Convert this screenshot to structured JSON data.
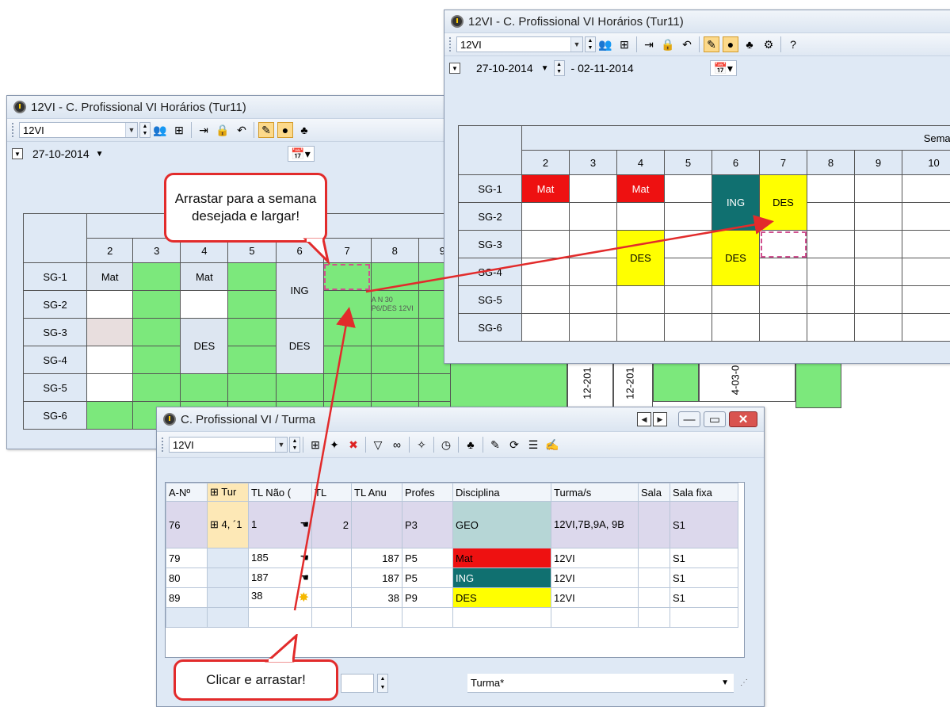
{
  "back_window": {
    "title": "12VI - C. Profissional VI  Horários  (Tur11)",
    "class_combo": "12VI",
    "date_start": "27-10-2014",
    "columns": [
      "",
      "2",
      "3",
      "4",
      "5",
      "6",
      "7",
      "8",
      "9"
    ],
    "rows": [
      "SG-1",
      "SG-2",
      "SG-3",
      "SG-4",
      "SG-5",
      "SG-6"
    ],
    "cells": {
      "mat1": "Mat",
      "mat2": "Mat",
      "ing": "ING",
      "des1": "DES",
      "des2": "DES"
    },
    "drag_ghost_line1": "A N 30",
    "drag_ghost_line2": "P6/DES  12VI",
    "rotated_dates": [
      "12-201",
      "12-201",
      "4-03-0"
    ]
  },
  "front_window": {
    "title": "12VI - C. Profissional VI  Horários  (Tur11)",
    "class_combo": "12VI",
    "date_start": "27-10-2014",
    "date_end": "- 02-11-2014",
    "week_header": "Semana",
    "columns": [
      "2",
      "3",
      "4",
      "5",
      "6",
      "7",
      "8",
      "9",
      "10"
    ],
    "rows": [
      "SG-1",
      "SG-2",
      "SG-3",
      "SG-4",
      "SG-5",
      "SG-6"
    ],
    "cells": {
      "mat1": "Mat",
      "mat2": "Mat",
      "ing": "ING",
      "des_drop": "DES",
      "des1": "DES",
      "des2": "DES"
    }
  },
  "list_window": {
    "title": "C. Profissional VI / Turma",
    "class_combo": "12VI",
    "headers": [
      "A-Nº",
      "⊞ Tur",
      "TL Não (",
      "TL",
      "TL Anu",
      "Profes",
      "Disciplina",
      "Turma/s",
      "Sala",
      "Sala fixa"
    ],
    "rows": [
      {
        "a": "76",
        "tur": "⊞ 4, ´1",
        "tl_nao": "1",
        "tl": "2",
        "tl_anual": "",
        "prof": "P3",
        "disc": "GEO",
        "turmas": "12VI,7B,9A, 9B",
        "sala": "",
        "sala_fixa": "S1"
      },
      {
        "a": "79",
        "tur": "",
        "tl_nao": "185",
        "tl": "",
        "tl_anual": "187",
        "prof": "P5",
        "disc": "Mat",
        "turmas": "12VI",
        "sala": "",
        "sala_fixa": "S1"
      },
      {
        "a": "80",
        "tur": "",
        "tl_nao": "187",
        "tl": "",
        "tl_anual": "187",
        "prof": "P5",
        "disc": "ING",
        "turmas": "12VI",
        "sala": "",
        "sala_fixa": "S1"
      },
      {
        "a": "89",
        "tur": "",
        "tl_nao": "38",
        "tl": "",
        "tl_anual": "38",
        "prof": "P9",
        "disc": "DES",
        "turmas": "12VI",
        "sala": "",
        "sala_fixa": "S1"
      }
    ],
    "bottom_combo": "Turma*"
  },
  "callouts": {
    "drag": "Arrastar para a semana desejada e largar!",
    "click": "Clicar e arrastar!"
  },
  "colors": {
    "mat": "#ee1111",
    "des": "#ffff00",
    "ing": "#107070",
    "free": "#7ce87c",
    "arrow": "#e22b2b"
  }
}
